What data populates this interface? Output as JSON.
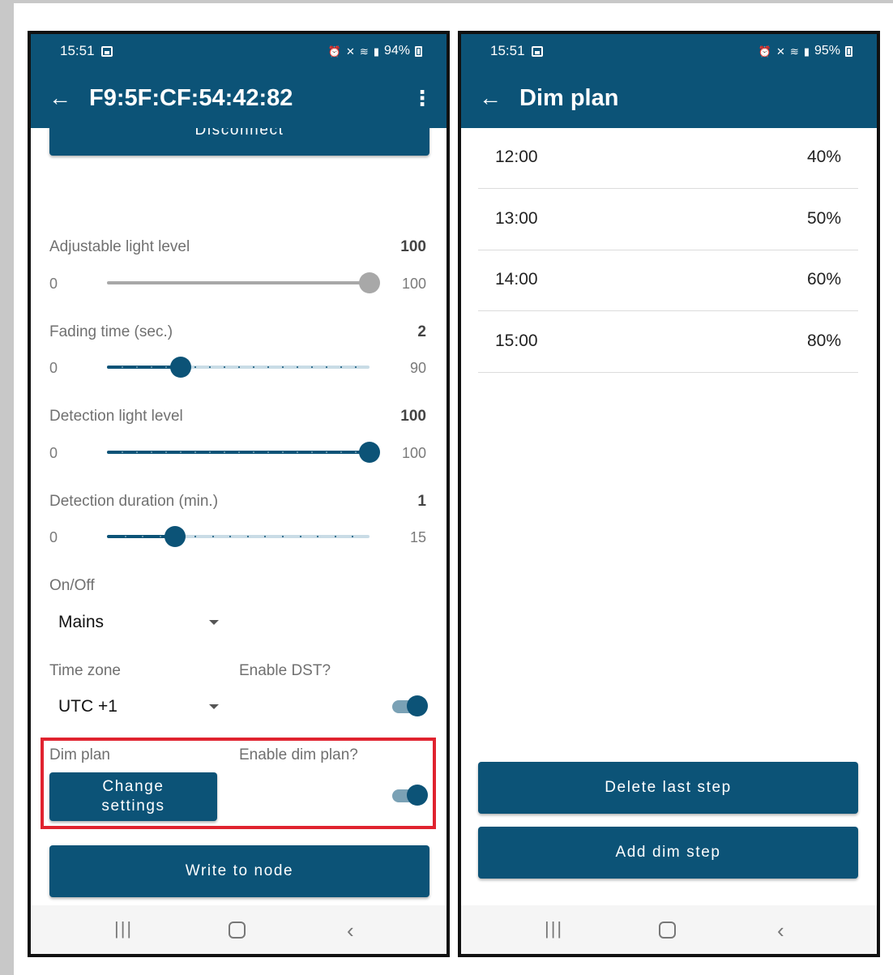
{
  "left_phone": {
    "status": {
      "time": "15:51",
      "battery": "94%"
    },
    "appbar": {
      "title": "F9:5F:CF:54:42:82"
    },
    "disconnect_label": "Disconnect",
    "sliders": [
      {
        "label": "Adjustable light level",
        "value": "100",
        "min": "0",
        "max": "100",
        "level": 1.0,
        "enabled": false
      },
      {
        "label": "Fading time (sec.)",
        "value": "2",
        "min": "0",
        "max": "90",
        "level": 0.28,
        "enabled": true
      },
      {
        "label": "Detection light level",
        "value": "100",
        "min": "0",
        "max": "100",
        "level": 1.0,
        "enabled": true
      },
      {
        "label": "Detection duration (min.)",
        "value": "1",
        "min": "0",
        "max": "15",
        "level": 0.26,
        "enabled": true
      }
    ],
    "onoff": {
      "label": "On/Off",
      "value": "Mains"
    },
    "timezone": {
      "label": "Time zone",
      "value": "UTC +1"
    },
    "dst": {
      "label": "Enable DST?",
      "on": true
    },
    "dimplan": {
      "label": "Dim plan",
      "button": "Change settings",
      "enable_label": "Enable dim plan?",
      "on": true
    },
    "write_label": "Write to node"
  },
  "right_phone": {
    "status": {
      "time": "15:51",
      "battery": "95%"
    },
    "appbar": {
      "title": "Dim plan"
    },
    "steps": [
      {
        "time": "12:00",
        "level": "40%"
      },
      {
        "time": "13:00",
        "level": "50%"
      },
      {
        "time": "14:00",
        "level": "60%"
      },
      {
        "time": "15:00",
        "level": "80%"
      }
    ],
    "delete_label": "Delete last step",
    "add_label": "Add dim step"
  },
  "colors": {
    "primary": "#0c5377",
    "highlight": "#e0232f",
    "track_inactive": "#c9dce6",
    "disabled": "#a8a8a8"
  },
  "icons": [
    "back-arrow-icon",
    "kebab-menu-icon",
    "gallery-icon",
    "alarm-icon",
    "mute-icon",
    "wifi-icon",
    "signal-icon",
    "battery-icon",
    "recents-icon",
    "home-icon",
    "nav-back-icon"
  ]
}
